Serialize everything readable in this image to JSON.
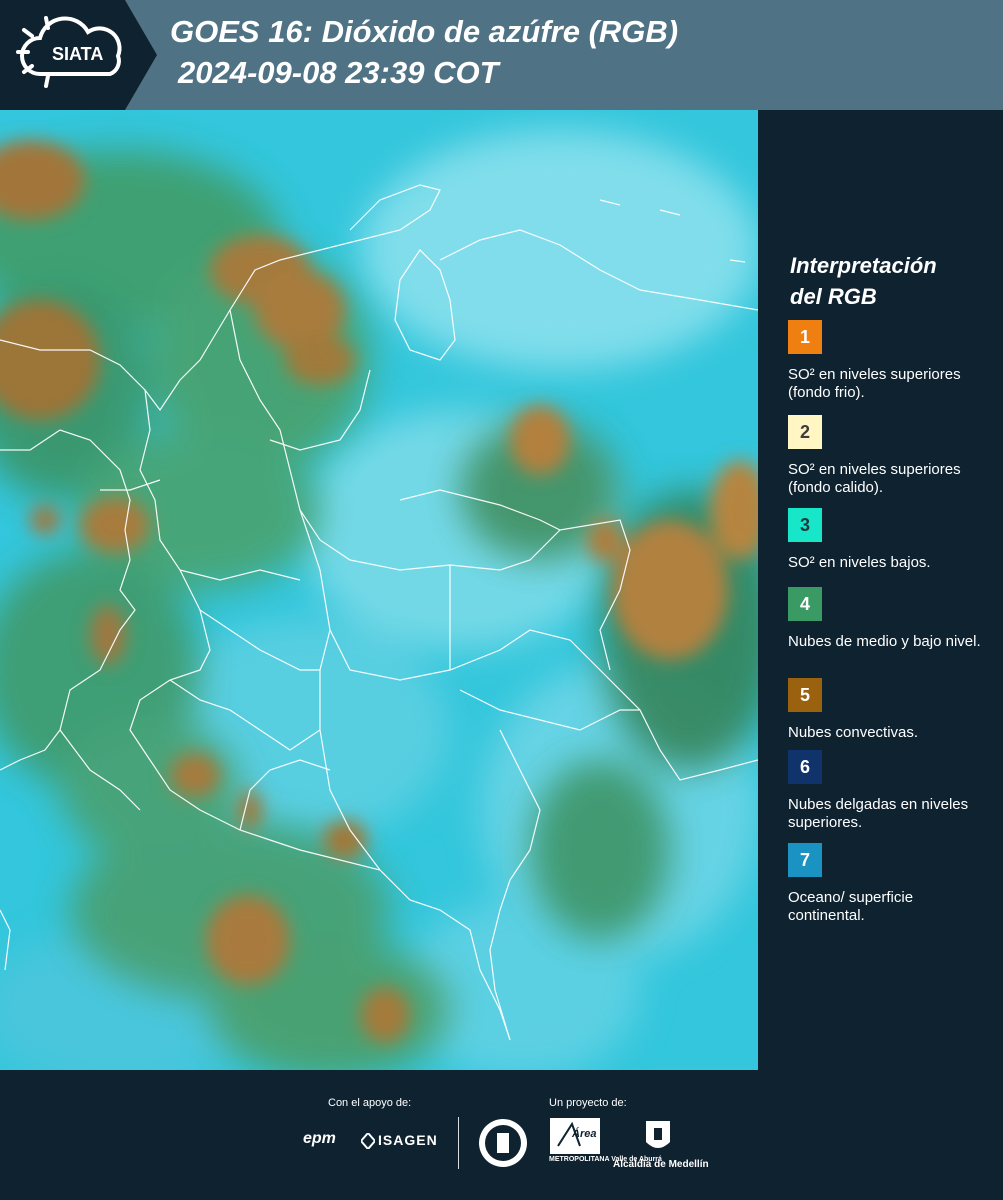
{
  "header": {
    "logo_text": "SIATA",
    "title_line1": "GOES 16: Dióxido de azúfre (RGB)",
    "title_line2": "2024-09-08 23:39 COT"
  },
  "legend": {
    "title_line1": "Interpretación",
    "title_line2": "del RGB",
    "items": [
      {
        "number": "1",
        "color": "#f07f12",
        "text_color": "#ffffff",
        "description": "SO² en niveles superiores (fondo frio)."
      },
      {
        "number": "2",
        "color": "#fff6c4",
        "text_color": "#3d3d3d",
        "description": "SO² en niveles superiores (fondo calido)."
      },
      {
        "number": "3",
        "color": "#18e6c8",
        "text_color": "#1a3a40",
        "description": "SO² en niveles bajos."
      },
      {
        "number": "4",
        "color": "#3a9a63",
        "text_color": "#ffffff",
        "description": "Nubes de medio y bajo nivel."
      },
      {
        "number": "5",
        "color": "#9a620f",
        "text_color": "#ffffff",
        "description": "Nubes convectivas."
      },
      {
        "number": "6",
        "color": "#10336b",
        "text_color": "#ffffff",
        "description": "Nubes delgadas en niveles superiores."
      },
      {
        "number": "7",
        "color": "#1a93c2",
        "text_color": "#ffffff",
        "description": "Oceano/ superficie continental."
      }
    ]
  },
  "footer": {
    "support_label": "Con el apoyo de:",
    "project_label": "Un proyecto de:",
    "sponsor1": "epm",
    "sponsor2": "ISAGEN",
    "area_caption": "METROPOLITANA Valle de Aburrá",
    "area_script": "Área",
    "alcaldia_caption": "Alcaldía de Medellín"
  },
  "colors": {
    "header_bg": "#4f7384",
    "logo_bg": "#0f2230",
    "page_bg": "#0f2230",
    "ocean": "#34c8dc",
    "convective": "#a7783c",
    "low_cloud": "#3f9c68"
  }
}
